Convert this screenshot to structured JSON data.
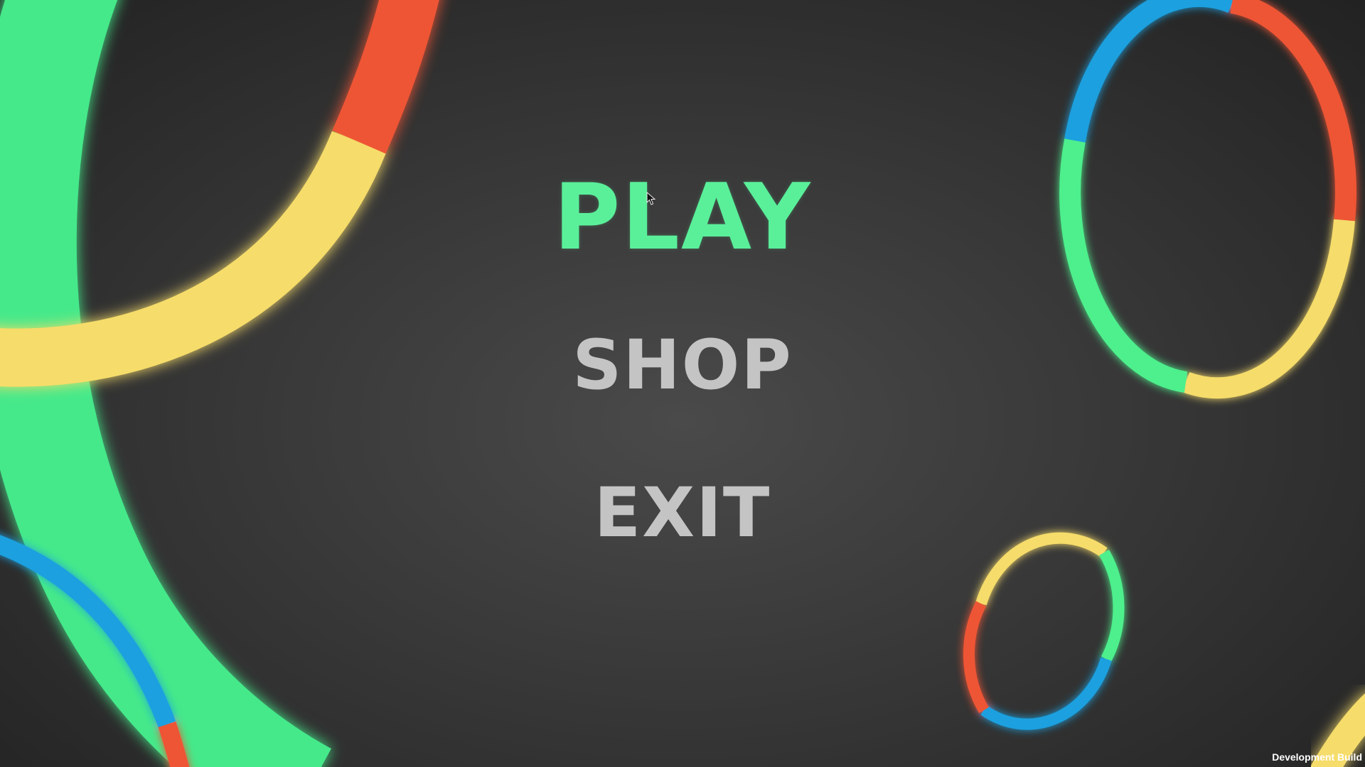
{
  "menu": {
    "play_label": "PLAY",
    "shop_label": "SHOP",
    "exit_label": "EXIT"
  },
  "footer": {
    "build_label": "Development Build"
  },
  "colors": {
    "green": "#4ef08c",
    "yellow": "#f6dc6a",
    "red": "#ee5535",
    "blue": "#1ba0df",
    "menu_active": "#5af09a",
    "menu_inactive": "#c4c4c4",
    "background": "#3a3a3a"
  },
  "icons": {
    "cursor": "mouse-pointer-icon"
  }
}
